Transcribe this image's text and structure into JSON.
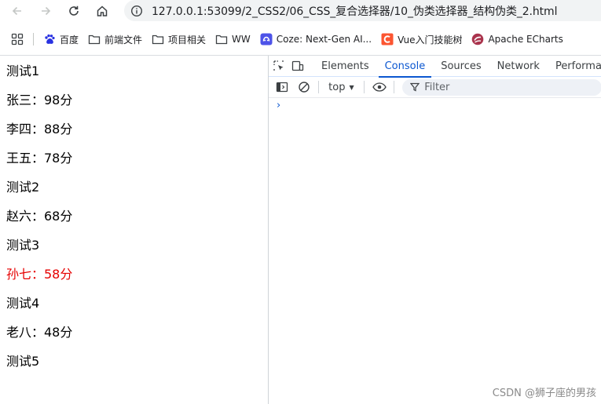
{
  "browser": {
    "url": "127.0.0.1:53099/2_CSS2/06_CSS_复合选择器/10_伪类选择器_结构伪类_2.html",
    "bookmarks": [
      {
        "label": "百度",
        "icon": "paw-icon"
      },
      {
        "label": "前端文件",
        "icon": "folder-icon"
      },
      {
        "label": "项目相关",
        "icon": "folder-icon"
      },
      {
        "label": "WW",
        "icon": "folder-icon"
      },
      {
        "label": "Coze: Next-Gen AI...",
        "icon": "coze-icon"
      },
      {
        "label": "Vue入门技能树",
        "icon": "csdn-icon"
      },
      {
        "label": "Apache ECharts",
        "icon": "echarts-icon"
      }
    ]
  },
  "page": {
    "lines": [
      {
        "text": "测试1",
        "highlight": false
      },
      {
        "text": "张三：98分",
        "highlight": false
      },
      {
        "text": "李四：88分",
        "highlight": false
      },
      {
        "text": "王五：78分",
        "highlight": false
      },
      {
        "text": "测试2",
        "highlight": false
      },
      {
        "text": "赵六：68分",
        "highlight": false
      },
      {
        "text": "测试3",
        "highlight": false
      },
      {
        "text": "孙七：58分",
        "highlight": true
      },
      {
        "text": "测试4",
        "highlight": false
      },
      {
        "text": "老八：48分",
        "highlight": false
      },
      {
        "text": "测试5",
        "highlight": false
      }
    ],
    "highlight_color": "#e60000"
  },
  "devtools": {
    "tabs": [
      {
        "label": "Elements",
        "active": false
      },
      {
        "label": "Console",
        "active": true
      },
      {
        "label": "Sources",
        "active": false
      },
      {
        "label": "Network",
        "active": false
      },
      {
        "label": "Performance",
        "active": false
      }
    ],
    "context": "top",
    "filter_placeholder": "Filter",
    "prompt": "›",
    "accent_color": "#0b57d0"
  },
  "watermark": "CSDN @狮子座的男孩"
}
